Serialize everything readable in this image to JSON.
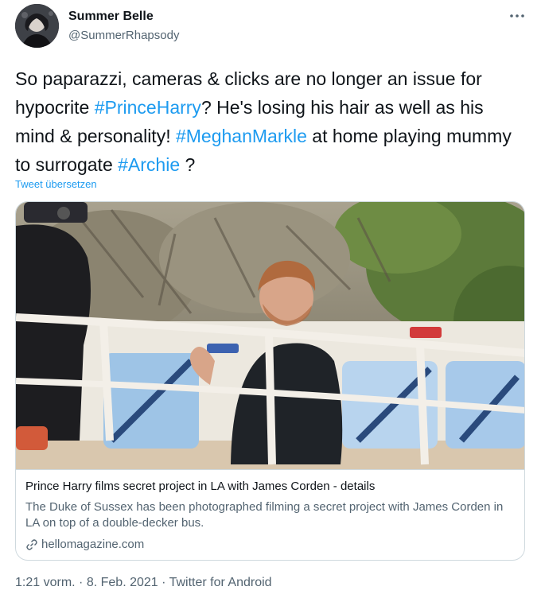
{
  "author": {
    "name": "Summer Belle",
    "handle": "@SummerRhapsody",
    "avatar_icon": "profile-photo"
  },
  "menu_icon": "more-horizontal-icon",
  "tweet": {
    "parts": [
      "So paparazzi, cameras & clicks are no longer an issue for hypocrite ",
      "#PrinceHarry",
      "? He's losing his hair as well as his mind & personality! ",
      "#MeghanMarkle",
      " at home playing mummy to surrogate ",
      "#Archie",
      " ?"
    ],
    "translate_label": "Tweet übersetzen"
  },
  "card": {
    "title": "Prince Harry films secret project in LA with James Corden - details",
    "description": "The Duke of Sussex has been photographed filming a secret project with James Corden in LA on top of a double-decker bus.",
    "domain": "hellomagazine.com",
    "link_icon": "link-icon"
  },
  "meta": {
    "time": "1:21 vorm.",
    "separator": "·",
    "date": "8. Feb. 2021",
    "source": "Twitter for Android"
  },
  "colors": {
    "link": "#1d9bf0",
    "text": "#0f1419",
    "secondary": "#536471",
    "border": "#cfd9de"
  }
}
